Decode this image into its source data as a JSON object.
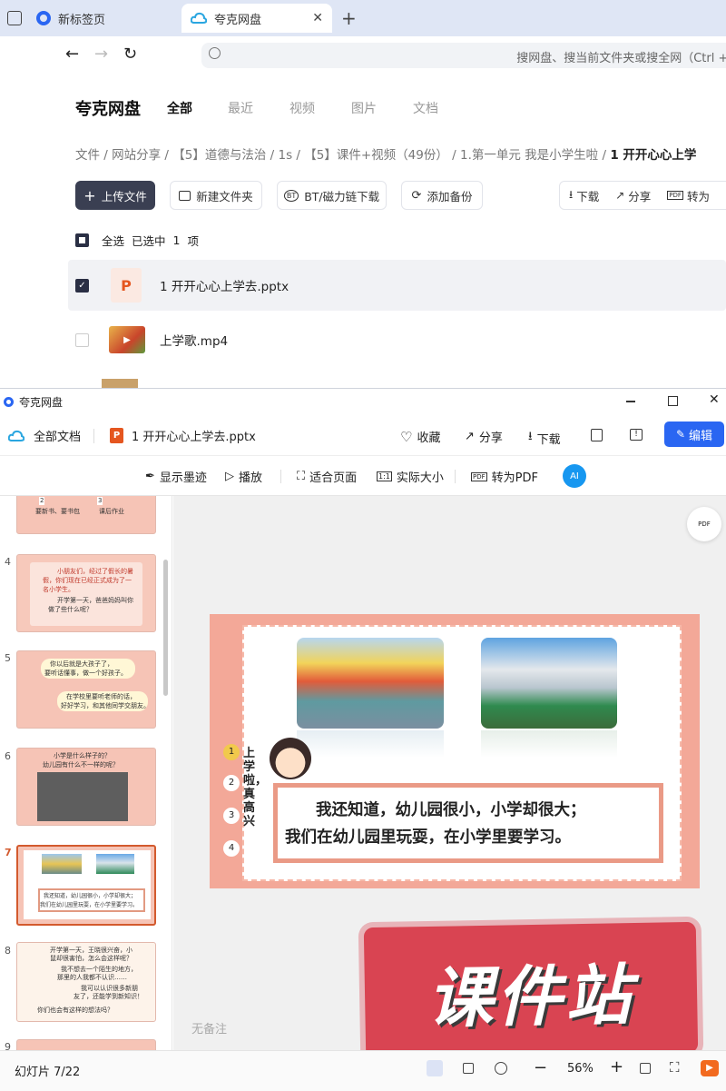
{
  "browser": {
    "tabs": [
      {
        "label": "新标签页"
      },
      {
        "label": "夸克网盘"
      }
    ],
    "address_placeholder": "搜网盘、搜当前文件夹或搜全网（Ctrl + F"
  },
  "drive": {
    "brand": "夸克网盘",
    "nav": [
      "全部",
      "最近",
      "视频",
      "图片",
      "文档"
    ],
    "breadcrumb": [
      "文件",
      "网站分享",
      "【5】道德与法治",
      "1s",
      "【5】课件+视频（49份）",
      "1.第一单元 我是小学生啦",
      "1 开开心心上学"
    ],
    "toolbar": {
      "upload": "上传文件",
      "new_folder": "新建文件夹",
      "bt": "BT/磁力链下载",
      "backup": "添加备份",
      "download": "下载",
      "share": "分享",
      "convert": "转为"
    },
    "selection": {
      "select_all": "全选",
      "selected": "已选中",
      "count": "1",
      "unit": "项"
    },
    "files": [
      {
        "name": "1 开开心心上学去.pptx",
        "checked": true
      },
      {
        "name": "上学歌.mp4",
        "checked": false
      }
    ]
  },
  "viewer": {
    "window_title": "夸克网盘",
    "all_docs": "全部文档",
    "filename": "1 开开心心上学去.pptx",
    "actions": {
      "favorite": "收藏",
      "share": "分享",
      "download": "下载",
      "edit": "编辑"
    },
    "tools": {
      "ink": "显示墨迹",
      "play": "播放",
      "fit": "适合页面",
      "actual": "实际大小",
      "pdf": "转为PDF"
    },
    "ai_badge": "AI",
    "thumbnails": [
      {
        "num": "4",
        "lines": [
          "小朋友们，经过了假长的暑",
          "假，你们现在已经正式成为了一",
          "名小学生。",
          "开学第一天，爸爸妈妈叫你",
          "做了些什么呢？"
        ]
      },
      {
        "num": "5",
        "lines": [
          "你以后就是大孩子了，",
          "要听话懂事，做一个好孩子。",
          "在学校里要听老师的话，",
          "好好学习，和其他同学交朋友。"
        ]
      },
      {
        "num": "6",
        "lines": [
          "小学是什么样子的？",
          "幼儿园有什么不一样的呢？"
        ]
      },
      {
        "num": "7",
        "lines": [
          "我还知道，幼儿园很小，小学却很大；",
          "我们在幼儿园里玩耍，在小学里要学习。"
        ]
      },
      {
        "num": "8",
        "lines": [
          "开学第一天，王晓很兴奋，小",
          "鼠却很害怕，怎么会这样呢？",
          "我不想去一个陌生的地方，",
          "那里的人我都不认识……",
          "我可以认识很多新朋",
          "友了，还能学到新知识！",
          "你们也会有这样的想法吗？"
        ]
      }
    ],
    "top_thumb_labels": [
      "2",
      "3",
      "要新书、要书包",
      "课后作业"
    ],
    "slide": {
      "side_title": "上学啦，真高兴",
      "numbers": [
        "1",
        "2",
        "3",
        "4"
      ],
      "text_line1": "我还知道，幼儿园很小，小学却很大；",
      "text_line2": "我们在幼儿园里玩耍，在小学里要学习。"
    },
    "notes": "无备注",
    "status": "幻灯片 7/22",
    "zoom": "56%",
    "watermark": "课件站"
  }
}
